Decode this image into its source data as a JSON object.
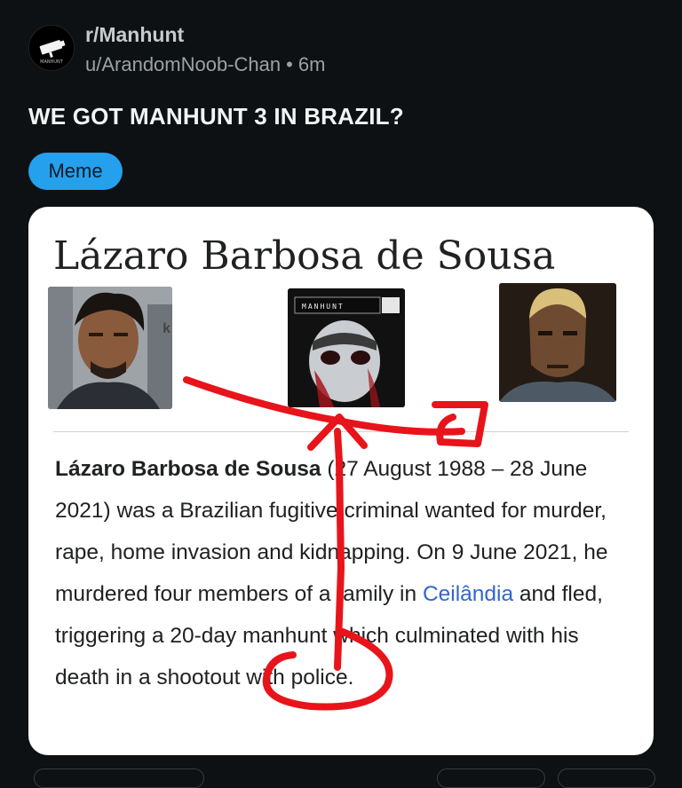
{
  "post": {
    "subreddit": "r/Manhunt",
    "author": "u/ArandomNoob-Chan",
    "separator": "•",
    "age": "6m",
    "title": "WE GOT MANHUNT 3 IN BRAZIL?",
    "flair": "Meme",
    "subreddit_icon": "manhunt-camera-logo-icon"
  },
  "wiki": {
    "title": "Lázaro Barbosa de Sousa",
    "game_cover_text": "MANHUNT",
    "bio_name": "Lázaro Barbosa de Sousa",
    "bio_part1": " (27 August 1988 – 28 June 2021) was a Brazilian fugitive criminal wanted for murder, rape, home invasion and kidnapping. On 9 June 2021, he murdered four members of a family in ",
    "bio_link": "Ceilândia",
    "bio_part2": " and fled, triggering a 20-day manhunt which culminated with his death in a shootout with police."
  },
  "colors": {
    "background": "#0e1113",
    "flair": "#24a0ed",
    "annotation": "#e8141b",
    "link": "#3366cc"
  }
}
